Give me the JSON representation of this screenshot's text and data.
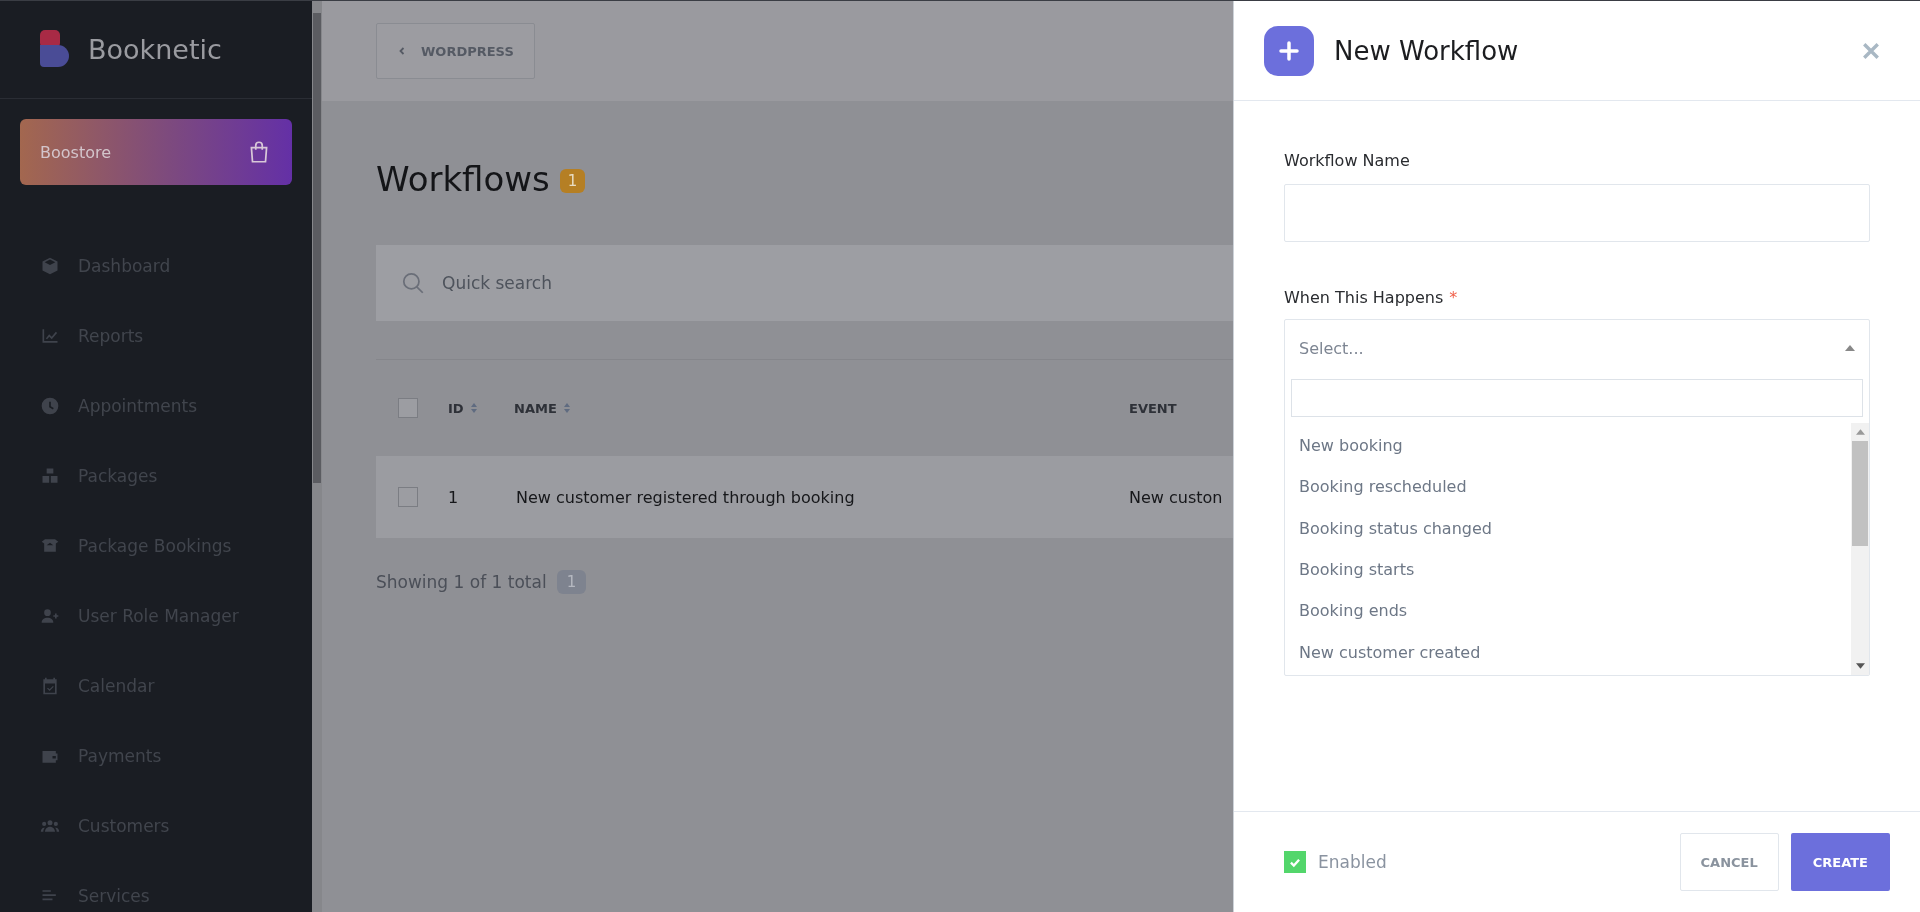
{
  "sidebar": {
    "brand": "Booknetic",
    "store_button": "Boostore",
    "items": [
      {
        "label": "Dashboard"
      },
      {
        "label": "Reports"
      },
      {
        "label": "Appointments"
      },
      {
        "label": "Packages"
      },
      {
        "label": "Package Bookings"
      },
      {
        "label": "User Role Manager"
      },
      {
        "label": "Calendar"
      },
      {
        "label": "Payments"
      },
      {
        "label": "Customers"
      },
      {
        "label": "Services"
      }
    ]
  },
  "main": {
    "back_button": "WORDPRESS",
    "title": "Workflows",
    "count": "1",
    "search": {
      "placeholder": "Quick search"
    },
    "table": {
      "select_all_checked": false,
      "columns": [
        {
          "label": "ID",
          "sortable": true
        },
        {
          "label": "NAME",
          "sortable": true
        },
        {
          "label": "EVENT",
          "sortable": false
        }
      ],
      "rows": [
        {
          "checked": false,
          "cells": [
            "1",
            "New customer registered through booking",
            "New custon"
          ]
        }
      ]
    },
    "footer": {
      "text": "Showing 1 of 1 total",
      "badge": "1"
    }
  },
  "panel": {
    "title": "New Workflow",
    "name_field": {
      "label": "Workflow Name"
    },
    "event_field": {
      "label": "When This Happens",
      "required": true,
      "required_mark": "*",
      "placeholder": "Select...",
      "expanded": true,
      "options": [
        {
          "label": "New booking",
          "selected": false
        },
        {
          "label": "Booking rescheduled",
          "selected": false
        },
        {
          "label": "Booking status changed",
          "selected": false
        },
        {
          "label": "Booking starts",
          "selected": false
        },
        {
          "label": "Booking ends",
          "selected": false
        },
        {
          "label": "New customer created",
          "selected": false
        }
      ]
    },
    "enabled": {
      "label": "Enabled",
      "checked": true
    },
    "buttons": {
      "cancel": "CANCEL",
      "create": "CREATE"
    }
  }
}
